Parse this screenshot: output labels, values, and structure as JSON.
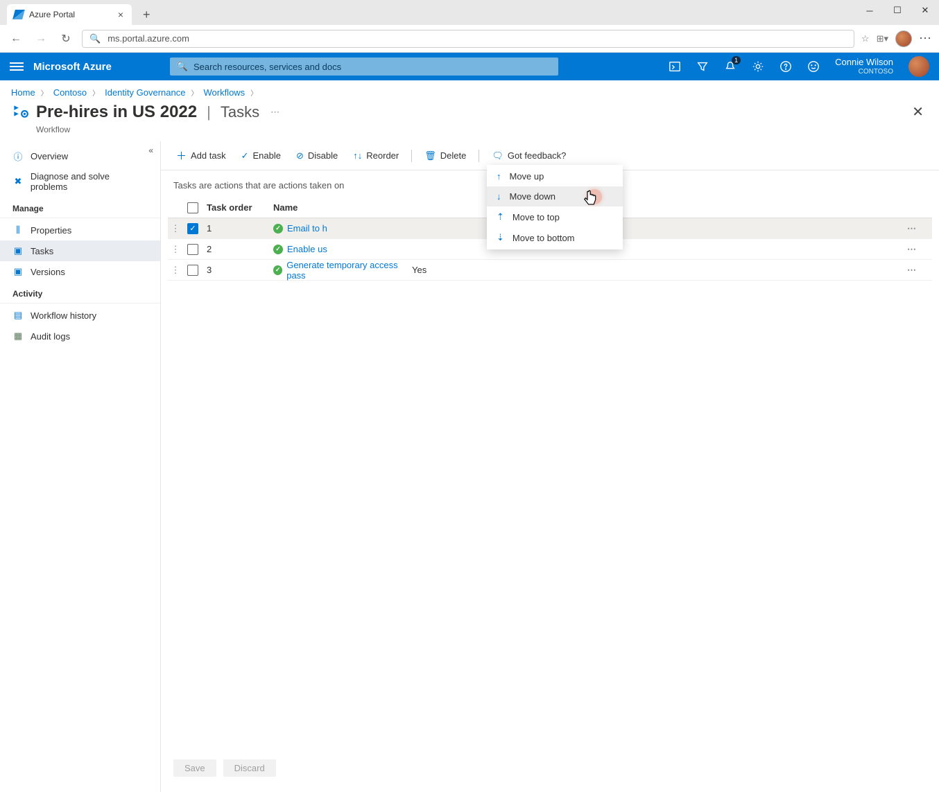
{
  "browser": {
    "tab_title": "Azure Portal",
    "url": "ms.portal.azure.com"
  },
  "azure": {
    "brand": "Microsoft Azure",
    "search_placeholder": "Search resources, services and docs",
    "notification_count": "1",
    "user_name": "Connie Wilson",
    "tenant": "CONTOSO"
  },
  "breadcrumb": {
    "items": [
      "Home",
      "Contoso",
      "Identity Governance",
      "Workflows"
    ]
  },
  "page": {
    "title_main": "Pre-hires in US 2022",
    "title_sub": "Tasks",
    "subtitle": "Workflow"
  },
  "sidebar": {
    "overview": "Overview",
    "diagnose": "Diagnose and solve problems",
    "manage_label": "Manage",
    "properties": "Properties",
    "tasks": "Tasks",
    "versions": "Versions",
    "activity_label": "Activity",
    "history": "Workflow history",
    "audit": "Audit logs"
  },
  "commands": {
    "add_task": "Add task",
    "enable": "Enable",
    "disable": "Disable",
    "reorder": "Reorder",
    "delete": "Delete",
    "feedback": "Got feedback?"
  },
  "description": "Tasks are actions that are actions taken on",
  "columns": {
    "task_order": "Task order",
    "name": "Name"
  },
  "rows": [
    {
      "order": "1",
      "name": "Email to h",
      "enabled": "",
      "checked": true
    },
    {
      "order": "2",
      "name": "Enable us",
      "enabled": "",
      "checked": false
    },
    {
      "order": "3",
      "name": "Generate temporary access pass",
      "enabled": "Yes",
      "checked": false
    }
  ],
  "dropdown": {
    "move_up": "Move up",
    "move_down": "Move down",
    "move_top": "Move to top",
    "move_bottom": "Move to bottom"
  },
  "footer": {
    "save": "Save",
    "discard": "Discard"
  }
}
